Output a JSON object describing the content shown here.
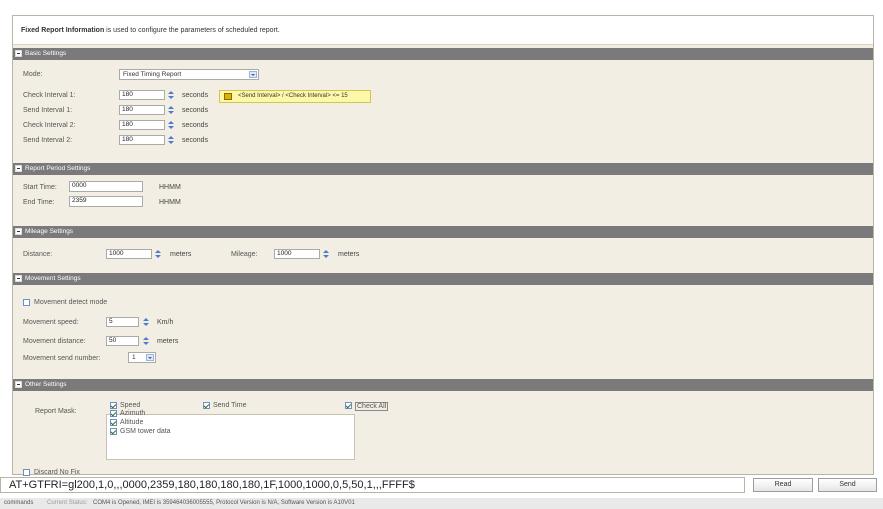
{
  "info": {
    "bold": "Fixed Report Information",
    "text": " is used to configure the parameters of scheduled report."
  },
  "sections": {
    "basic": "Basic Settings",
    "period": "Report Period Settings",
    "mileage": "Mileage Settings",
    "movement": "Movement Settings",
    "other": "Other Settings"
  },
  "basic": {
    "mode_label": "Mode:",
    "mode_value": "Fixed Timing Report",
    "rows": [
      {
        "label": "Check Interval 1:",
        "value": "180",
        "unit": "seconds"
      },
      {
        "label": "Send Interval 1:",
        "value": "180",
        "unit": "seconds"
      },
      {
        "label": "Check Interval 2:",
        "value": "180",
        "unit": "seconds"
      },
      {
        "label": "Send Interval 2:",
        "value": "180",
        "unit": "seconds"
      }
    ],
    "tip": "<Send Interval> / <Check Interval> <= 15"
  },
  "period": {
    "start_label": "Start Time:",
    "start_value": "0000",
    "start_unit": "HHMM",
    "end_label": "End Time:",
    "end_value": "2359",
    "end_unit": "HHMM"
  },
  "mileage": {
    "distance_label": "Distance:",
    "distance_value": "1000",
    "distance_unit": "meters",
    "mileage_label": "Mileage:",
    "mileage_value": "1000",
    "mileage_unit": "meters"
  },
  "movement": {
    "detect_label": "Movement detect mode",
    "detect_checked": false,
    "speed_label": "Movement speed:",
    "speed_value": "5",
    "speed_unit": "Km/h",
    "distance_label": "Movement distance:",
    "distance_value": "50",
    "distance_unit": "meters",
    "send_label": "Movement send number:",
    "send_value": "1"
  },
  "other": {
    "mask_label": "Report Mask:",
    "speed": "Speed",
    "azimuth": "Azimuth",
    "altitude": "Altitude",
    "gsm": "GSM tower data",
    "send_time": "Send Time",
    "check_all": "Check All",
    "discard_label": "Discard No Fix",
    "discard_checked": false
  },
  "command": "AT+GTFRI=gl200,1,0,,,0000,2359,180,180,180,180,1F,1000,1000,0,5,50,1,,,FFFF$",
  "buttons": {
    "read": "Read",
    "send": "Send"
  },
  "status": {
    "commands": "commands",
    "label": "Current Status:",
    "text": "COM4 is Opened, IMEI is 359464036005555, Protocol Version is N/A, Software Version is A10V01"
  }
}
